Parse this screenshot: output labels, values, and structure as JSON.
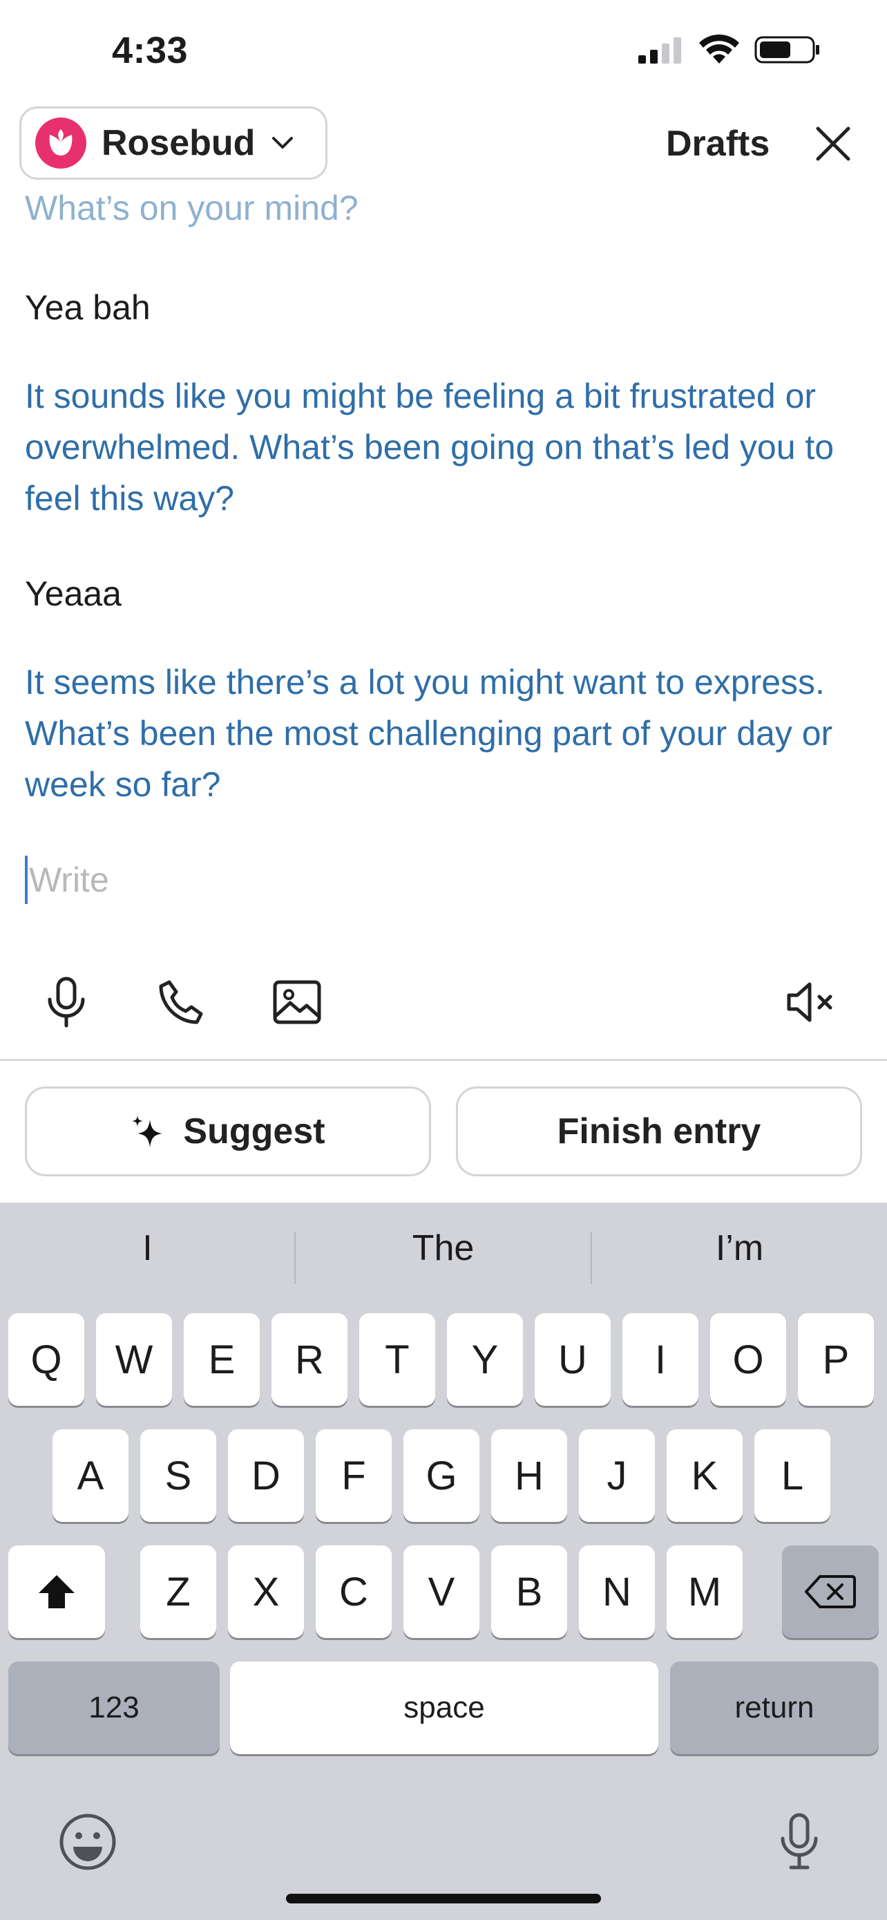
{
  "status_bar": {
    "time": "4:33"
  },
  "header": {
    "journal_name": "Rosebud",
    "drafts_label": "Drafts"
  },
  "conversation": {
    "prompt": "What’s on your mind?",
    "messages": [
      {
        "role": "user",
        "text": "Yea bah"
      },
      {
        "role": "ai",
        "text": "It sounds like you might be feeling a bit frustrated or overwhelmed. What’s been going on that’s led you to feel this way?"
      },
      {
        "role": "user",
        "text": "Yeaaa"
      },
      {
        "role": "ai",
        "text": "It seems like there’s a lot you might want to express. What’s been the most challenging part of your day or week so far?"
      }
    ],
    "input_placeholder": "Write"
  },
  "actions": {
    "suggest_label": "Suggest",
    "finish_label": "Finish entry"
  },
  "keyboard": {
    "suggestions": [
      "I",
      "The",
      "I’m"
    ],
    "row1": [
      "Q",
      "W",
      "E",
      "R",
      "T",
      "Y",
      "U",
      "I",
      "O",
      "P"
    ],
    "row2": [
      "A",
      "S",
      "D",
      "F",
      "G",
      "H",
      "J",
      "K",
      "L"
    ],
    "row3": [
      "Z",
      "X",
      "C",
      "V",
      "B",
      "N",
      "M"
    ],
    "numbers_label": "123",
    "space_label": "space",
    "return_label": "return"
  },
  "colors": {
    "brand": "#e8306f",
    "ai_text": "#2f6ea8",
    "prompt_text": "#8fb0d0",
    "keyboard_bg": "#d1d3d9"
  }
}
